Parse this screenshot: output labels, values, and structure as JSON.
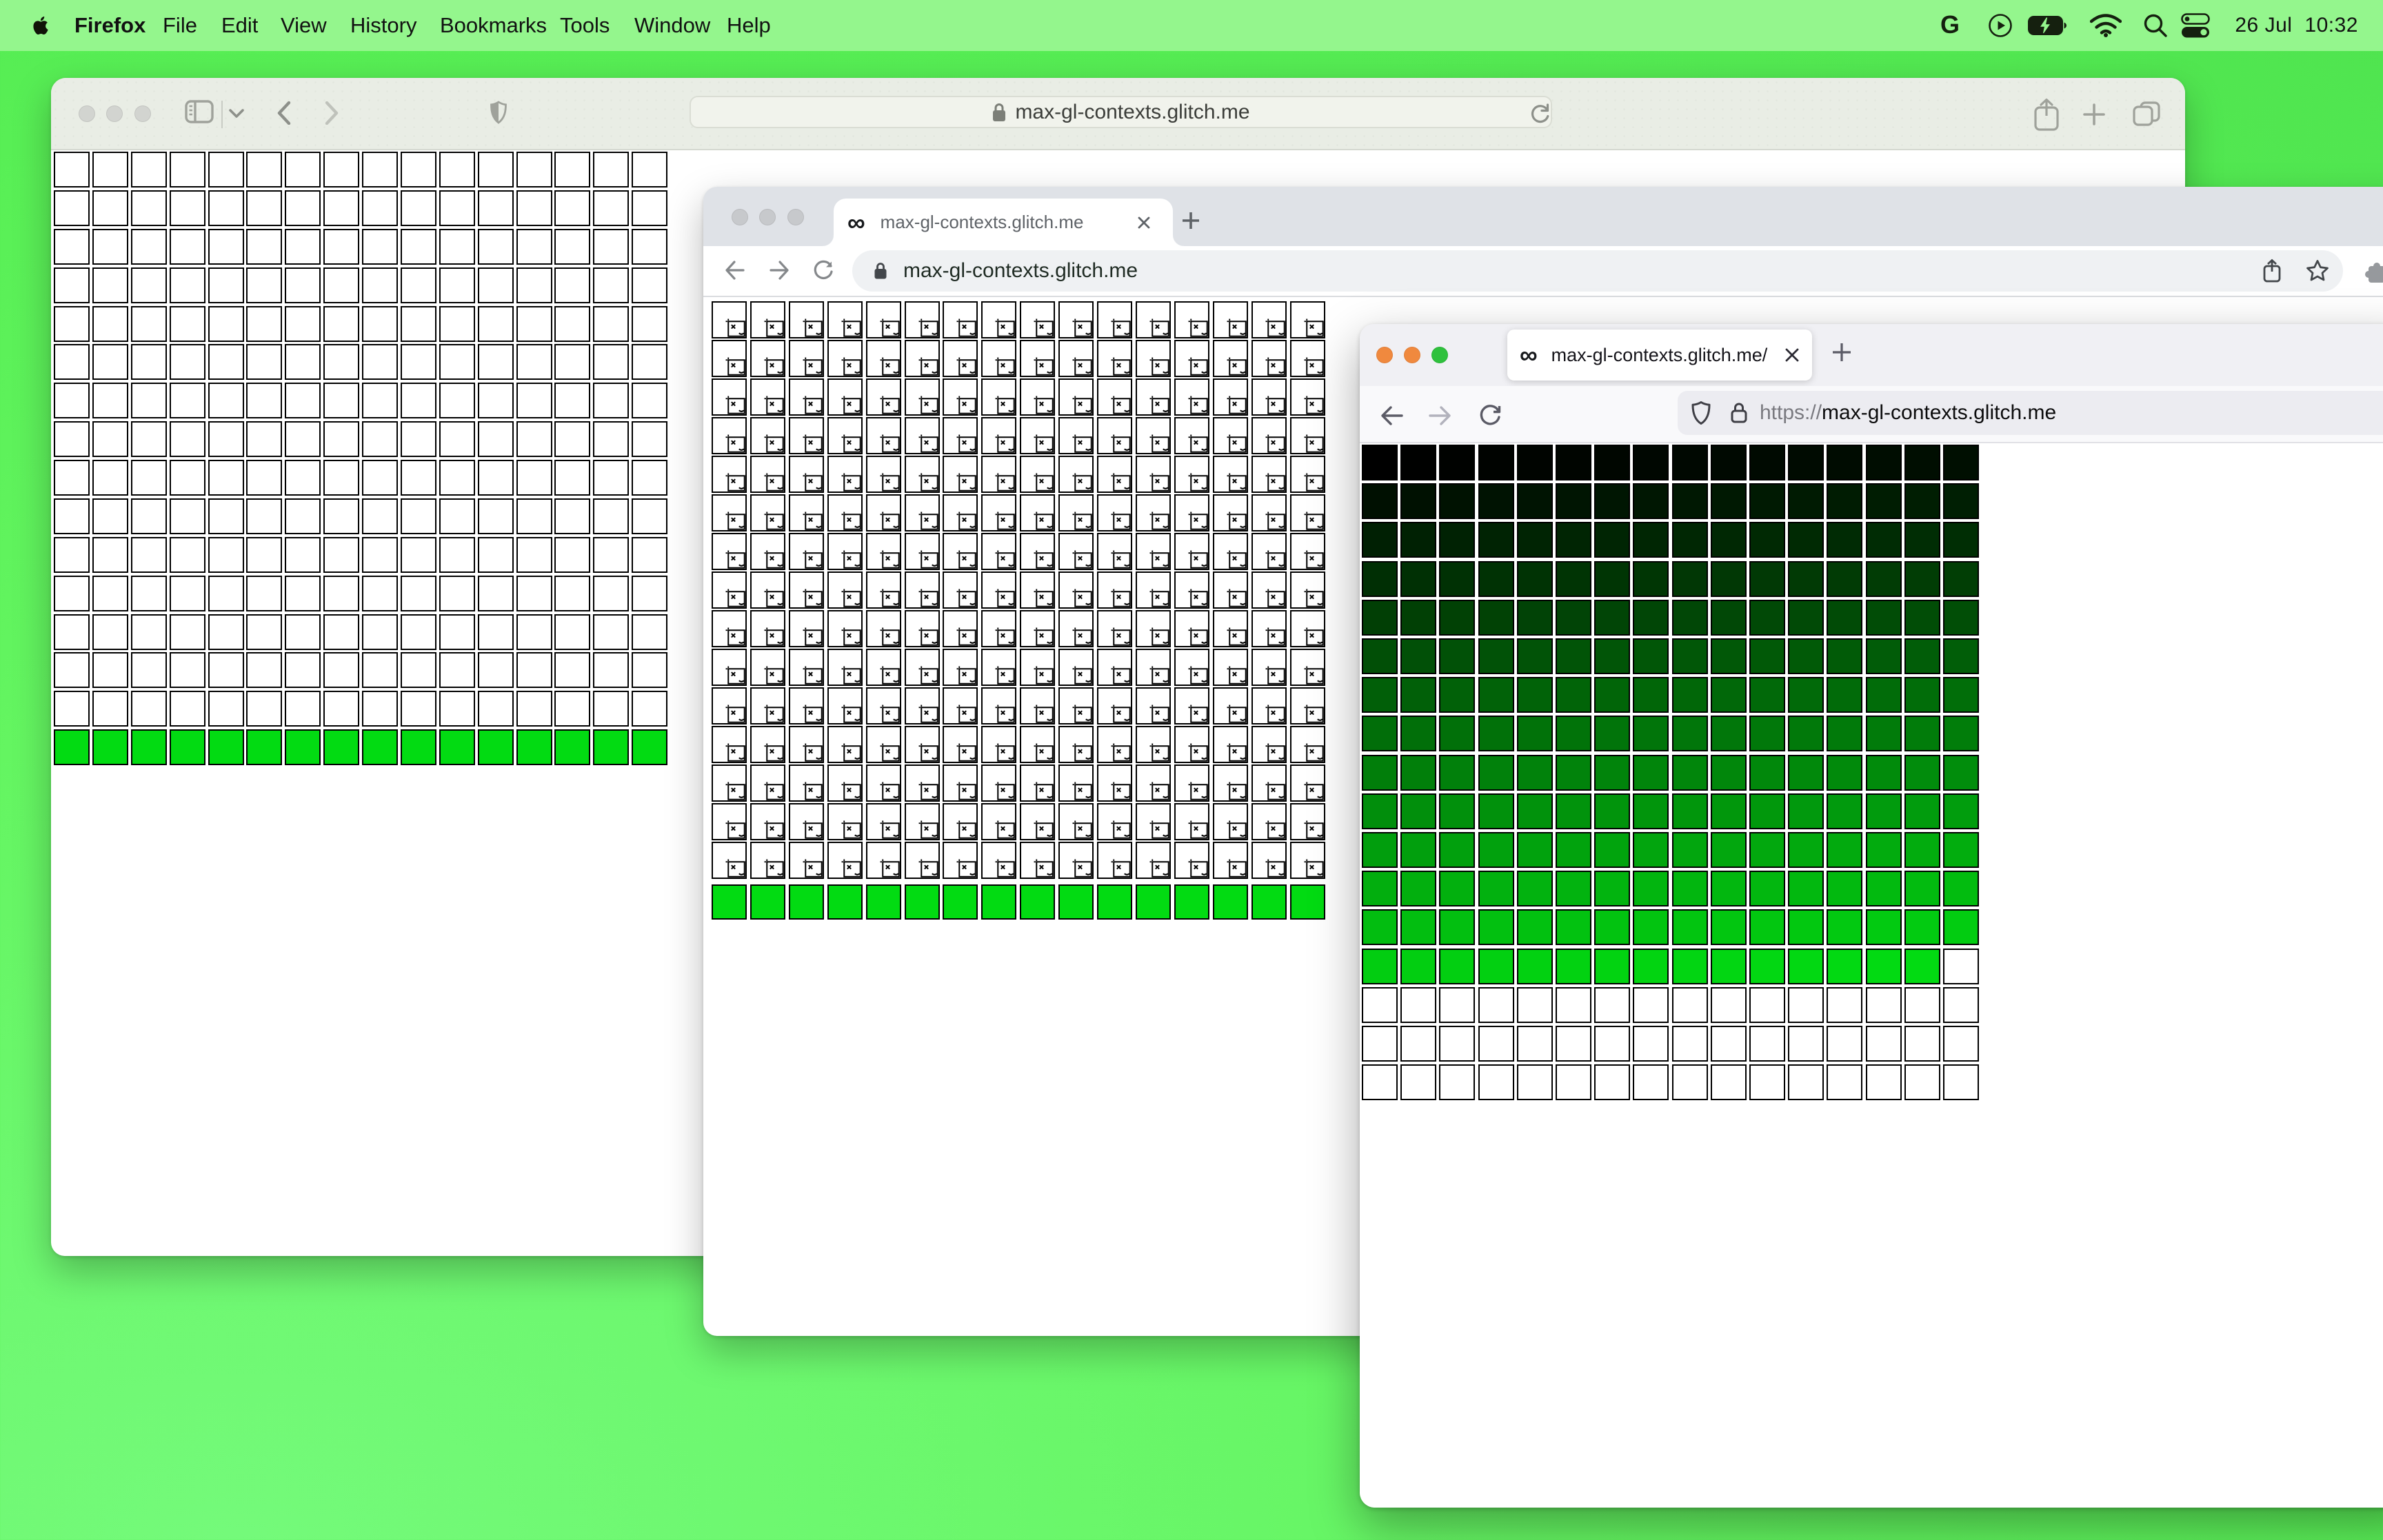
{
  "menu_bar": {
    "app_name": "Firefox",
    "menus": [
      "File",
      "Edit",
      "View",
      "History",
      "Bookmarks",
      "Tools",
      "Window",
      "Help"
    ],
    "status_icons": [
      "google-icon",
      "play-circle-icon",
      "battery-charging-icon",
      "wifi-icon",
      "search-icon",
      "control-center-icon"
    ],
    "date": "26 Jul",
    "time": "10:32"
  },
  "site": {
    "domain": "max-gl-contexts.glitch.me",
    "favicon_glyph": "∞",
    "green": "#02db12"
  },
  "safari_window": {
    "url": "max-gl-contexts.glitch.me",
    "grid": {
      "columns": 16,
      "rows": 16,
      "white_rows": 15,
      "green_rows": 1
    }
  },
  "chrome_window": {
    "tab_title": "max-gl-contexts.glitch.me",
    "url": "max-gl-contexts.glitch.me",
    "grid": {
      "columns": 16,
      "rows": 16,
      "broken_rows": 15,
      "green_rows": 1
    }
  },
  "firefox_window": {
    "tab_title": "max-gl-contexts.glitch.me/",
    "url_scheme": "https://",
    "url_host": "max-gl-contexts.glitch.me",
    "grid": {
      "columns": 16,
      "rows": 17,
      "gradient_cells": 223,
      "white_cells": 49
    }
  },
  "colors": {
    "desktop": "#5bef58",
    "menubar": "#94f68d",
    "traffic_inactive": "#d2d4d0",
    "firefox_traffic": [
      "#f0893e",
      "#f0893e",
      "#2fc13d"
    ]
  }
}
